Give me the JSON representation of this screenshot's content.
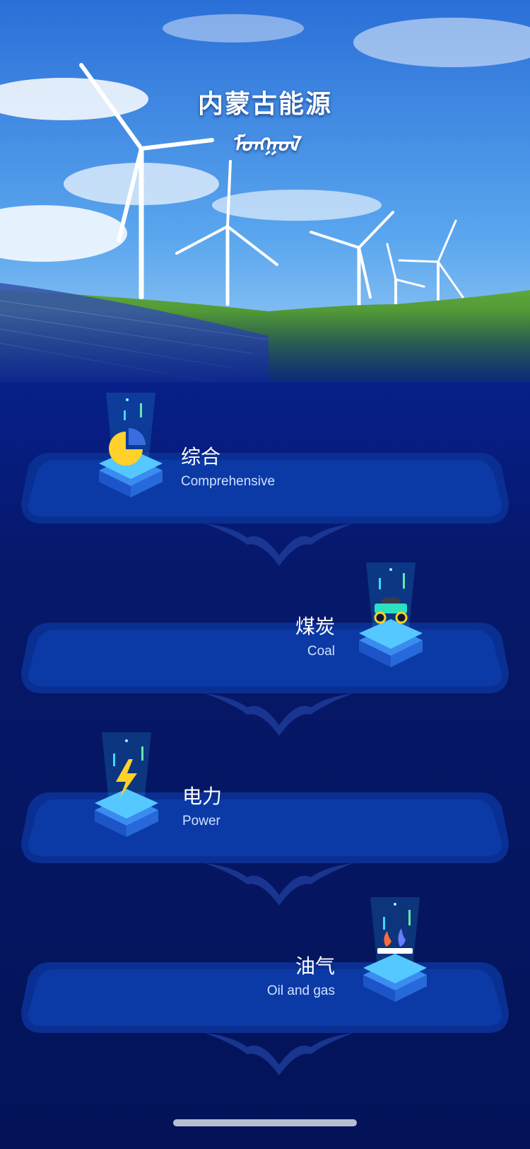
{
  "header": {
    "title_zh": "内蒙古能源",
    "title_mn": "ᠮᠣᠩᠭᠣᠯ"
  },
  "categories": [
    {
      "id": "comprehensive",
      "zh": "综合",
      "en": "Comprehensive",
      "icon": "pie-chart-icon"
    },
    {
      "id": "coal",
      "zh": "煤炭",
      "en": "Coal",
      "icon": "coal-cart-icon"
    },
    {
      "id": "power",
      "zh": "电力",
      "en": "Power",
      "icon": "lightning-icon"
    },
    {
      "id": "oil-gas",
      "zh": "油气",
      "en": "Oil and gas",
      "icon": "gas-flame-icon"
    }
  ],
  "colors": {
    "accent": "#2ec8ff",
    "card": "#0a3aa8",
    "background": "#031350"
  }
}
